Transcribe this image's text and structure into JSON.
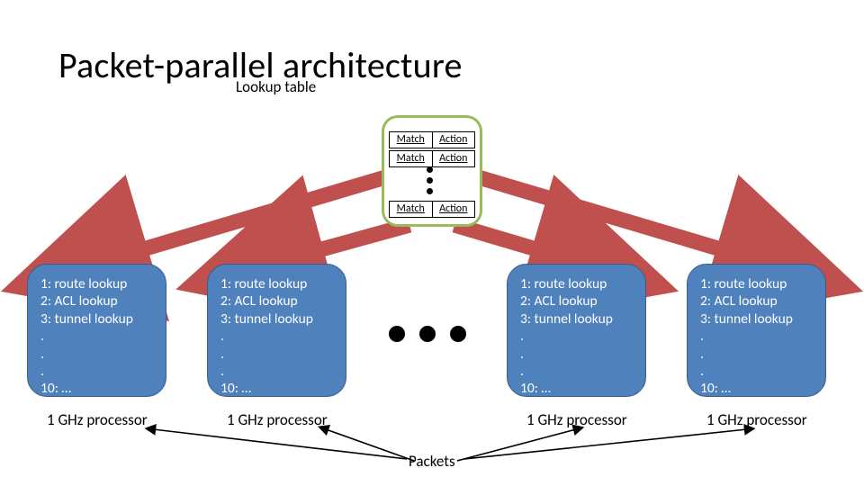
{
  "title": "Packet-parallel architecture",
  "subtitle": "Lookup table",
  "match_label": "Match",
  "action_label": "Action",
  "proc": {
    "l1": "1: route lookup",
    "l2": "2: ACL lookup",
    "l3": "3: tunnel lookup",
    "l4": ".",
    "l5": ".",
    "l6": ".",
    "l7": "10: …"
  },
  "proc_label": "1 GHz processor",
  "packets_label": "Packets"
}
